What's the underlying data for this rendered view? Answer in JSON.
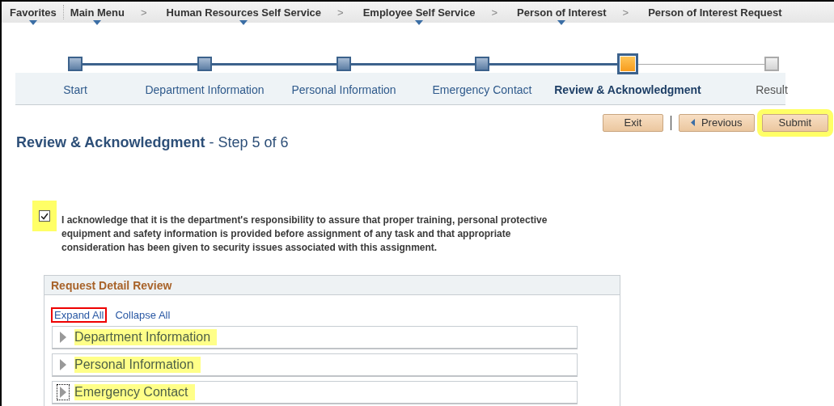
{
  "breadcrumb": [
    {
      "label": "Favorites",
      "menu": true
    },
    {
      "label": "Main Menu",
      "menu": true
    },
    {
      "label": "Human Resources Self Service",
      "menu": true,
      "separator": ">"
    },
    {
      "label": "Employee Self Service",
      "menu": true,
      "separator": ">"
    },
    {
      "label": "Person of Interest",
      "menu": true,
      "separator": ">"
    },
    {
      "label": "Person of Interest Request",
      "menu": false,
      "separator": ">"
    }
  ],
  "steps": [
    {
      "label": "Start",
      "completed": true,
      "selected": false
    },
    {
      "label": "Department Information",
      "completed": true,
      "selected": false
    },
    {
      "label": "Personal Information",
      "completed": true,
      "selected": false
    },
    {
      "label": "Emergency Contact",
      "completed": true,
      "selected": false
    },
    {
      "label": "Review & Acknowledgment",
      "completed": false,
      "selected": true
    },
    {
      "label": "Result",
      "completed": false,
      "selected": false
    }
  ],
  "buttons": [
    {
      "label": "Exit",
      "kind": "plain",
      "highlighted": false
    },
    {
      "label": "Previous",
      "kind": "back",
      "highlighted": false
    },
    {
      "label": "Submit",
      "kind": "plain",
      "highlighted": true
    }
  ],
  "page_title": {
    "title": "Review & Acknowledgment",
    "step": "- Step 5 of 6"
  },
  "acknowledgment": {
    "checked": true,
    "highlighted": true,
    "text": "I acknowledge that it is the department's responsibility to assure that proper training, personal protective equipment and safety information is provided before assignment of any task and that appropriate consideration has been given to security issues associated with this assignment."
  },
  "review_panel": {
    "title": "Request Detail Review",
    "links": [
      {
        "label": "Expand All",
        "outlined": true
      },
      {
        "label": "Collapse All",
        "outlined": false
      }
    ],
    "sections": [
      {
        "label": "Department Information",
        "expanded": false,
        "highlighted": true,
        "focused": false
      },
      {
        "label": "Personal Information",
        "expanded": false,
        "highlighted": true,
        "focused": false
      },
      {
        "label": "Emergency Contact",
        "expanded": false,
        "highlighted": true,
        "focused": true
      }
    ]
  }
}
